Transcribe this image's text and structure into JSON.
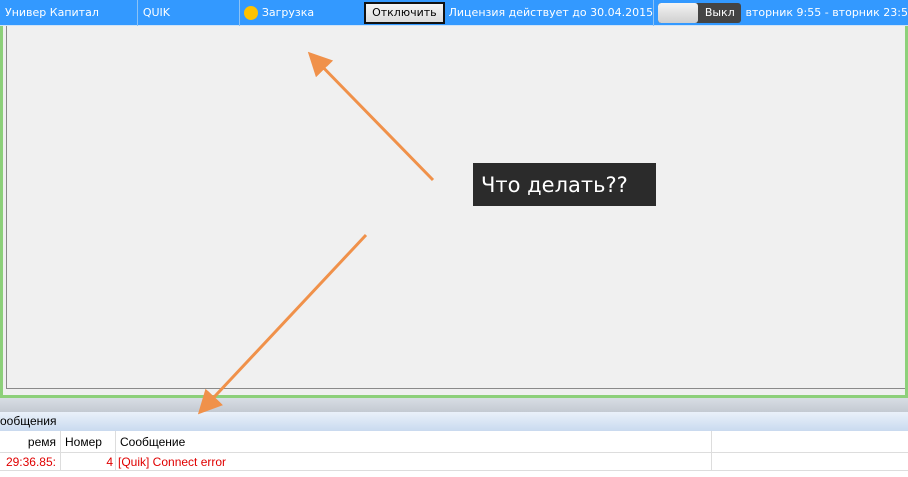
{
  "topbar": {
    "account": "Универ Капитал",
    "connector": "QUIK",
    "status": "Загрузка",
    "status_color": "#ffc200",
    "disconnect_label": "Отключить",
    "license": "Лицензия действует до 30.04.2015",
    "toggle_label": "Выкл",
    "toggle_on": false,
    "schedule": "вторник 9:55 - вторник 23:5"
  },
  "callout": "Что делать??",
  "messages": {
    "title": "ообщения",
    "columns": [
      "ремя",
      "Номер",
      "Сообщение"
    ],
    "rows": [
      {
        "time": ":29:36.85",
        "number": "4",
        "message": "[Quik] Connect error"
      }
    ]
  },
  "colors": {
    "accent": "#3399ff",
    "error": "#e00000",
    "arrow": "#f0914a"
  }
}
